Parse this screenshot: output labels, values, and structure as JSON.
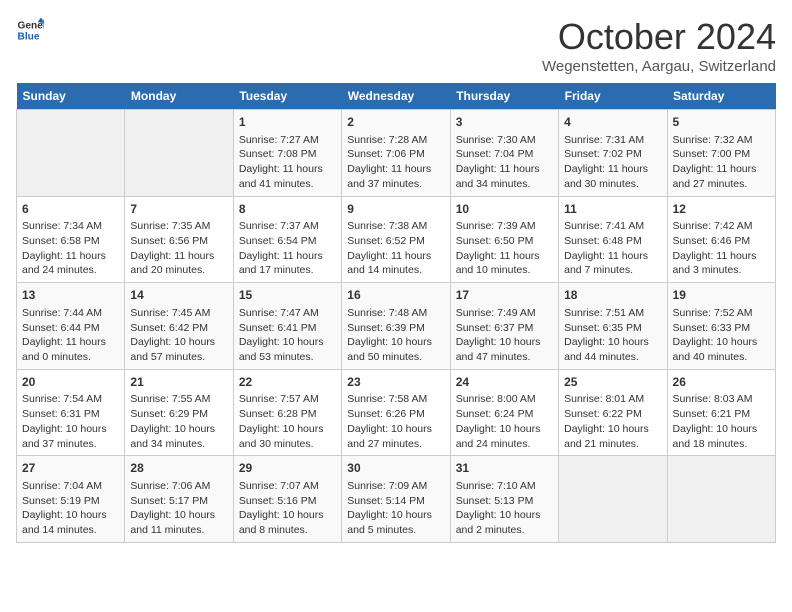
{
  "header": {
    "logo_general": "General",
    "logo_blue": "Blue",
    "month_title": "October 2024",
    "location": "Wegenstetten, Aargau, Switzerland"
  },
  "days_of_week": [
    "Sunday",
    "Monday",
    "Tuesday",
    "Wednesday",
    "Thursday",
    "Friday",
    "Saturday"
  ],
  "weeks": [
    [
      {
        "day": "",
        "empty": true
      },
      {
        "day": "",
        "empty": true
      },
      {
        "day": "1",
        "sunrise": "Sunrise: 7:27 AM",
        "sunset": "Sunset: 7:08 PM",
        "daylight": "Daylight: 11 hours and 41 minutes."
      },
      {
        "day": "2",
        "sunrise": "Sunrise: 7:28 AM",
        "sunset": "Sunset: 7:06 PM",
        "daylight": "Daylight: 11 hours and 37 minutes."
      },
      {
        "day": "3",
        "sunrise": "Sunrise: 7:30 AM",
        "sunset": "Sunset: 7:04 PM",
        "daylight": "Daylight: 11 hours and 34 minutes."
      },
      {
        "day": "4",
        "sunrise": "Sunrise: 7:31 AM",
        "sunset": "Sunset: 7:02 PM",
        "daylight": "Daylight: 11 hours and 30 minutes."
      },
      {
        "day": "5",
        "sunrise": "Sunrise: 7:32 AM",
        "sunset": "Sunset: 7:00 PM",
        "daylight": "Daylight: 11 hours and 27 minutes."
      }
    ],
    [
      {
        "day": "6",
        "sunrise": "Sunrise: 7:34 AM",
        "sunset": "Sunset: 6:58 PM",
        "daylight": "Daylight: 11 hours and 24 minutes."
      },
      {
        "day": "7",
        "sunrise": "Sunrise: 7:35 AM",
        "sunset": "Sunset: 6:56 PM",
        "daylight": "Daylight: 11 hours and 20 minutes."
      },
      {
        "day": "8",
        "sunrise": "Sunrise: 7:37 AM",
        "sunset": "Sunset: 6:54 PM",
        "daylight": "Daylight: 11 hours and 17 minutes."
      },
      {
        "day": "9",
        "sunrise": "Sunrise: 7:38 AM",
        "sunset": "Sunset: 6:52 PM",
        "daylight": "Daylight: 11 hours and 14 minutes."
      },
      {
        "day": "10",
        "sunrise": "Sunrise: 7:39 AM",
        "sunset": "Sunset: 6:50 PM",
        "daylight": "Daylight: 11 hours and 10 minutes."
      },
      {
        "day": "11",
        "sunrise": "Sunrise: 7:41 AM",
        "sunset": "Sunset: 6:48 PM",
        "daylight": "Daylight: 11 hours and 7 minutes."
      },
      {
        "day": "12",
        "sunrise": "Sunrise: 7:42 AM",
        "sunset": "Sunset: 6:46 PM",
        "daylight": "Daylight: 11 hours and 3 minutes."
      }
    ],
    [
      {
        "day": "13",
        "sunrise": "Sunrise: 7:44 AM",
        "sunset": "Sunset: 6:44 PM",
        "daylight": "Daylight: 11 hours and 0 minutes."
      },
      {
        "day": "14",
        "sunrise": "Sunrise: 7:45 AM",
        "sunset": "Sunset: 6:42 PM",
        "daylight": "Daylight: 10 hours and 57 minutes."
      },
      {
        "day": "15",
        "sunrise": "Sunrise: 7:47 AM",
        "sunset": "Sunset: 6:41 PM",
        "daylight": "Daylight: 10 hours and 53 minutes."
      },
      {
        "day": "16",
        "sunrise": "Sunrise: 7:48 AM",
        "sunset": "Sunset: 6:39 PM",
        "daylight": "Daylight: 10 hours and 50 minutes."
      },
      {
        "day": "17",
        "sunrise": "Sunrise: 7:49 AM",
        "sunset": "Sunset: 6:37 PM",
        "daylight": "Daylight: 10 hours and 47 minutes."
      },
      {
        "day": "18",
        "sunrise": "Sunrise: 7:51 AM",
        "sunset": "Sunset: 6:35 PM",
        "daylight": "Daylight: 10 hours and 44 minutes."
      },
      {
        "day": "19",
        "sunrise": "Sunrise: 7:52 AM",
        "sunset": "Sunset: 6:33 PM",
        "daylight": "Daylight: 10 hours and 40 minutes."
      }
    ],
    [
      {
        "day": "20",
        "sunrise": "Sunrise: 7:54 AM",
        "sunset": "Sunset: 6:31 PM",
        "daylight": "Daylight: 10 hours and 37 minutes."
      },
      {
        "day": "21",
        "sunrise": "Sunrise: 7:55 AM",
        "sunset": "Sunset: 6:29 PM",
        "daylight": "Daylight: 10 hours and 34 minutes."
      },
      {
        "day": "22",
        "sunrise": "Sunrise: 7:57 AM",
        "sunset": "Sunset: 6:28 PM",
        "daylight": "Daylight: 10 hours and 30 minutes."
      },
      {
        "day": "23",
        "sunrise": "Sunrise: 7:58 AM",
        "sunset": "Sunset: 6:26 PM",
        "daylight": "Daylight: 10 hours and 27 minutes."
      },
      {
        "day": "24",
        "sunrise": "Sunrise: 8:00 AM",
        "sunset": "Sunset: 6:24 PM",
        "daylight": "Daylight: 10 hours and 24 minutes."
      },
      {
        "day": "25",
        "sunrise": "Sunrise: 8:01 AM",
        "sunset": "Sunset: 6:22 PM",
        "daylight": "Daylight: 10 hours and 21 minutes."
      },
      {
        "day": "26",
        "sunrise": "Sunrise: 8:03 AM",
        "sunset": "Sunset: 6:21 PM",
        "daylight": "Daylight: 10 hours and 18 minutes."
      }
    ],
    [
      {
        "day": "27",
        "sunrise": "Sunrise: 7:04 AM",
        "sunset": "Sunset: 5:19 PM",
        "daylight": "Daylight: 10 hours and 14 minutes."
      },
      {
        "day": "28",
        "sunrise": "Sunrise: 7:06 AM",
        "sunset": "Sunset: 5:17 PM",
        "daylight": "Daylight: 10 hours and 11 minutes."
      },
      {
        "day": "29",
        "sunrise": "Sunrise: 7:07 AM",
        "sunset": "Sunset: 5:16 PM",
        "daylight": "Daylight: 10 hours and 8 minutes."
      },
      {
        "day": "30",
        "sunrise": "Sunrise: 7:09 AM",
        "sunset": "Sunset: 5:14 PM",
        "daylight": "Daylight: 10 hours and 5 minutes."
      },
      {
        "day": "31",
        "sunrise": "Sunrise: 7:10 AM",
        "sunset": "Sunset: 5:13 PM",
        "daylight": "Daylight: 10 hours and 2 minutes."
      },
      {
        "day": "",
        "empty": true
      },
      {
        "day": "",
        "empty": true
      }
    ]
  ]
}
